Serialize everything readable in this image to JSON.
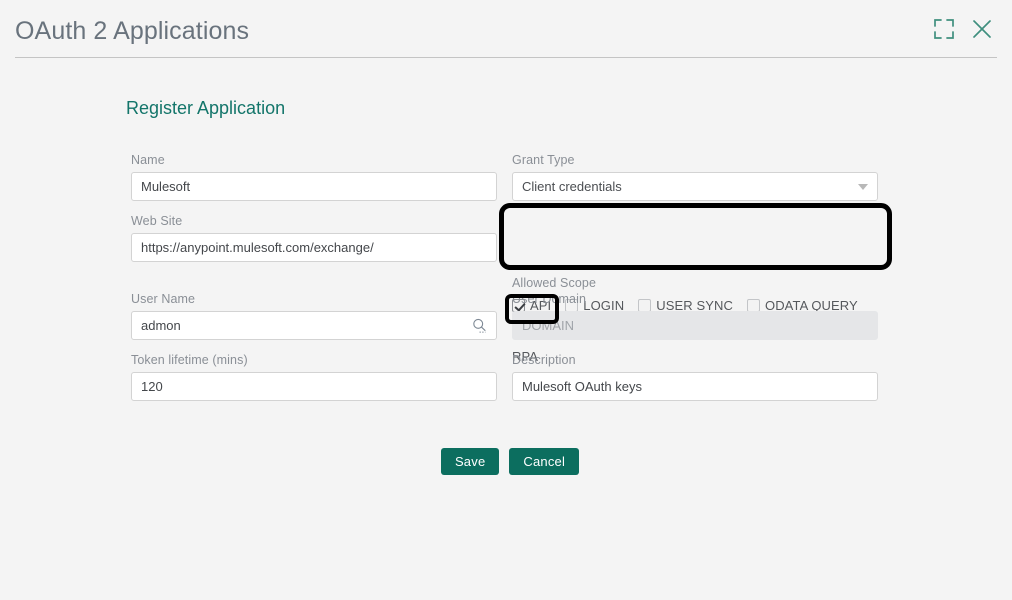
{
  "header": {
    "title": "OAuth 2 Applications",
    "expand_icon": "expand-icon",
    "close_icon": "close-icon",
    "accent_color": "#3f8f7e"
  },
  "form": {
    "section_title": "Register Application",
    "fields": {
      "name": {
        "label": "Name",
        "value": "Mulesoft",
        "placeholder": ""
      },
      "grant_type": {
        "label": "Grant Type",
        "value": "Client credentials",
        "options": [
          "Client credentials"
        ],
        "caret_icon": "chevron-down-icon",
        "highlighted": true
      },
      "web_site": {
        "label": "Web Site",
        "value": "https://anypoint.mulesoft.com/exchange/",
        "placeholder": ""
      },
      "allowed_scope": {
        "label": "Allowed Scope",
        "items": [
          {
            "label": "API",
            "checked": true,
            "highlighted": true
          },
          {
            "label": "LOGIN",
            "checked": false,
            "highlighted": false
          },
          {
            "label": "USER SYNC",
            "checked": false,
            "highlighted": false
          },
          {
            "label": "ODATA QUERY",
            "checked": false,
            "highlighted": false
          },
          {
            "label": "RPA",
            "checked": false,
            "highlighted": false
          }
        ]
      },
      "user_name": {
        "label": "User Name",
        "value": "admon",
        "placeholder": "",
        "search_icon": "search-icon"
      },
      "user_domain": {
        "label": "User Domain",
        "value": "",
        "placeholder": "DOMAIN",
        "disabled": true
      },
      "token_lifetime": {
        "label": "Token lifetime (mins)",
        "value": "120",
        "placeholder": ""
      },
      "description": {
        "label": "Description",
        "value": "Mulesoft OAuth keys",
        "placeholder": ""
      }
    },
    "actions": {
      "save_label": "Save",
      "cancel_label": "Cancel",
      "button_color": "#0c6e5f"
    }
  },
  "theme": {
    "background": "#f4f4f4",
    "title_color": "#69737d",
    "section_title_color": "#13756a",
    "label_color": "#8a8f96",
    "highlight_color": "#000000"
  }
}
